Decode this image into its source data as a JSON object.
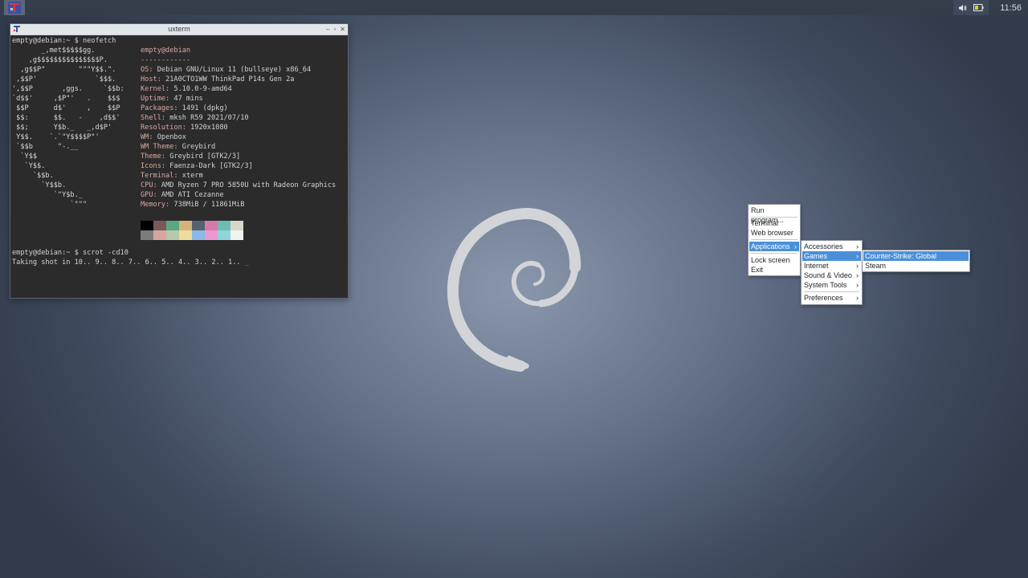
{
  "panel": {
    "clock": "11:56"
  },
  "window": {
    "title": "uxterm"
  },
  "terminal": {
    "prompt1": "empty@debian:~ $ neofetch",
    "logo": [
      "       _,met$$$$$gg.",
      "    ,g$$$$$$$$$$$$$$$P.",
      "  ,g$$P\"        \"\"\"Y$$.\".",
      " ,$$P'              `$$$.",
      "',$$P       ,ggs.     `$$b:",
      "`d$$'     ,$P\"'   .    $$$",
      " $$P      d$'     ,    $$P",
      " $$:      $$.   -    ,d$$'",
      " $$;      Y$b._   _,d$P'",
      " Y$$.    `.`\"Y$$$$P\"'",
      " `$$b      \"-.__",
      "  `Y$$",
      "   `Y$$.",
      "     `$$b.",
      "       `Y$$b.",
      "          `\"Y$b._",
      "              `\"\"\""
    ],
    "header": "empty@debian",
    "underline": "------------",
    "info": [
      {
        "k": "OS",
        "v": "Debian GNU/Linux 11 (bullseye) x86_64"
      },
      {
        "k": "Host",
        "v": "21A0CTO1WW ThinkPad P14s Gen 2a"
      },
      {
        "k": "Kernel",
        "v": "5.10.0-9-amd64"
      },
      {
        "k": "Uptime",
        "v": "47 mins"
      },
      {
        "k": "Packages",
        "v": "1491 (dpkg)"
      },
      {
        "k": "Shell",
        "v": "mksh R59 2021/07/10"
      },
      {
        "k": "Resolution",
        "v": "1920x1080"
      },
      {
        "k": "WM",
        "v": "Openbox"
      },
      {
        "k": "WM Theme",
        "v": "Greybird"
      },
      {
        "k": "Theme",
        "v": "Greybird [GTK2/3]"
      },
      {
        "k": "Icons",
        "v": "Faenza-Dark [GTK2/3]"
      },
      {
        "k": "Terminal",
        "v": "xterm"
      },
      {
        "k": "CPU",
        "v": "AMD Ryzen 7 PRO 5850U with Radeon Graphics"
      },
      {
        "k": "GPU",
        "v": "AMD ATI Cezanne"
      },
      {
        "k": "Memory",
        "v": "738MiB / 11861MiB"
      }
    ],
    "palette_top": [
      "#000000",
      "#7a5a58",
      "#5aa883",
      "#d4b27c",
      "#556272",
      "#d87aa8",
      "#6fbcb5",
      "#d8d6c6"
    ],
    "palette_bottom": [
      "#7c7c7c",
      "#d9a5a0",
      "#b9c8a8",
      "#eedc9e",
      "#8cb8e8",
      "#ea9ad2",
      "#8ed6d9",
      "#f2f2f2"
    ],
    "prompt2": "empty@debian:~ $ scrot -cd10",
    "countdown": "Taking shot in 10.. 9.. 8.. 7.. 6.. 5.. 4.. 3.. 2.. 1.. ",
    "cursor": "_"
  },
  "root_menu": {
    "items": [
      "Run program...",
      "Terminal",
      "Web browser",
      "Applications",
      "Lock screen",
      "Exit"
    ]
  },
  "apps_menu": {
    "items": [
      "Accessories",
      "Games",
      "Internet",
      "Sound & Video",
      "System Tools",
      "Preferences"
    ]
  },
  "games_menu": {
    "items": [
      "Counter-Strike: Global Offensive",
      "Steam"
    ]
  },
  "colors": {
    "menu_highlight": "#4a90d9",
    "terminal_bg": "#2b2b2b",
    "key_color": "#d7aaa2",
    "cursor": "#35c935"
  }
}
